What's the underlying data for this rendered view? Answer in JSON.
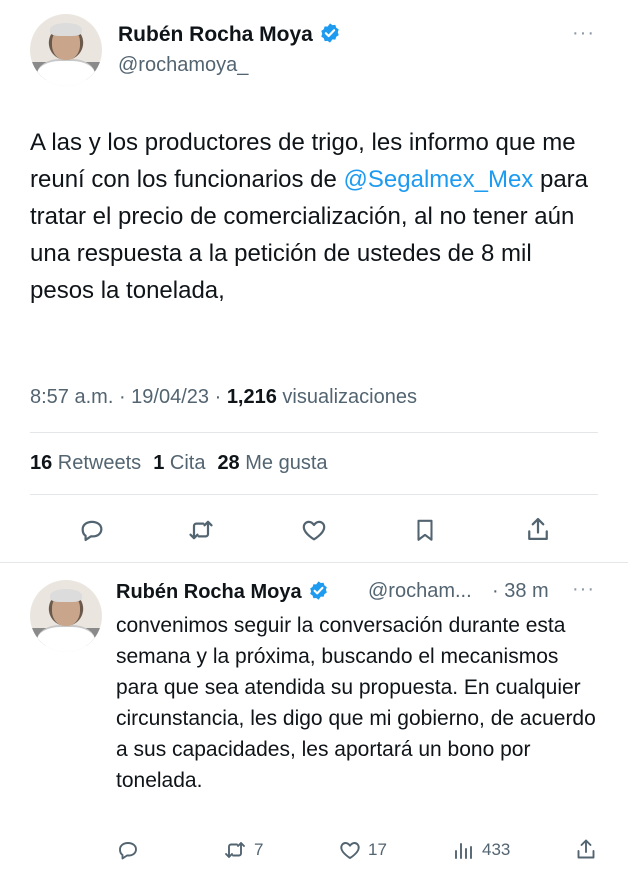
{
  "tweet": {
    "author_name": "Rubén Rocha Moya",
    "author_handle": "@rochamoya_",
    "text_before_link": "A las y los productores de trigo, les informo que me reuní con los funcionarios de ",
    "mention": "@Segalmex_Mex",
    "text_after_link": " para tratar el precio de comercialización, al no tener aún una respuesta a la petición de ustedes de 8 mil pesos la tonelada,",
    "time": "8:57 a.m.",
    "sep1": " · ",
    "date": "19/04/23",
    "sep2": " · ",
    "views_count": "1,216",
    "views_label": " visualizaciones",
    "retweets_count": "16",
    "retweets_label": " Retweets",
    "quotes_count": "1",
    "quotes_label": " Cita",
    "likes_count": "28",
    "likes_label": " Me gusta",
    "more_glyph": "···"
  },
  "reply": {
    "author_name": "Rubén Rocha Moya",
    "author_handle_trunc": "@rocham...",
    "time_ago": "· 38 m",
    "text": "convenimos seguir la conversación durante esta semana y la próxima, buscando el mecanismos para que sea atendida su propuesta. En cualquier circunstancia, les digo que mi gobierno, de acuerdo a sus capacidades, les aportará un bono por tonelada.",
    "retweets": "7",
    "likes": "17",
    "views": "433",
    "more_glyph": "···"
  },
  "colors": {
    "text": "#0f1419",
    "secondary": "#536471",
    "link": "#1d9bf0",
    "verified": "#1d9bf0",
    "divider": "#e3e7ea"
  },
  "icons": [
    "verified-badge-icon",
    "reply-icon",
    "retweet-icon",
    "like-icon",
    "bookmark-icon",
    "share-icon",
    "views-icon",
    "more-icon"
  ]
}
